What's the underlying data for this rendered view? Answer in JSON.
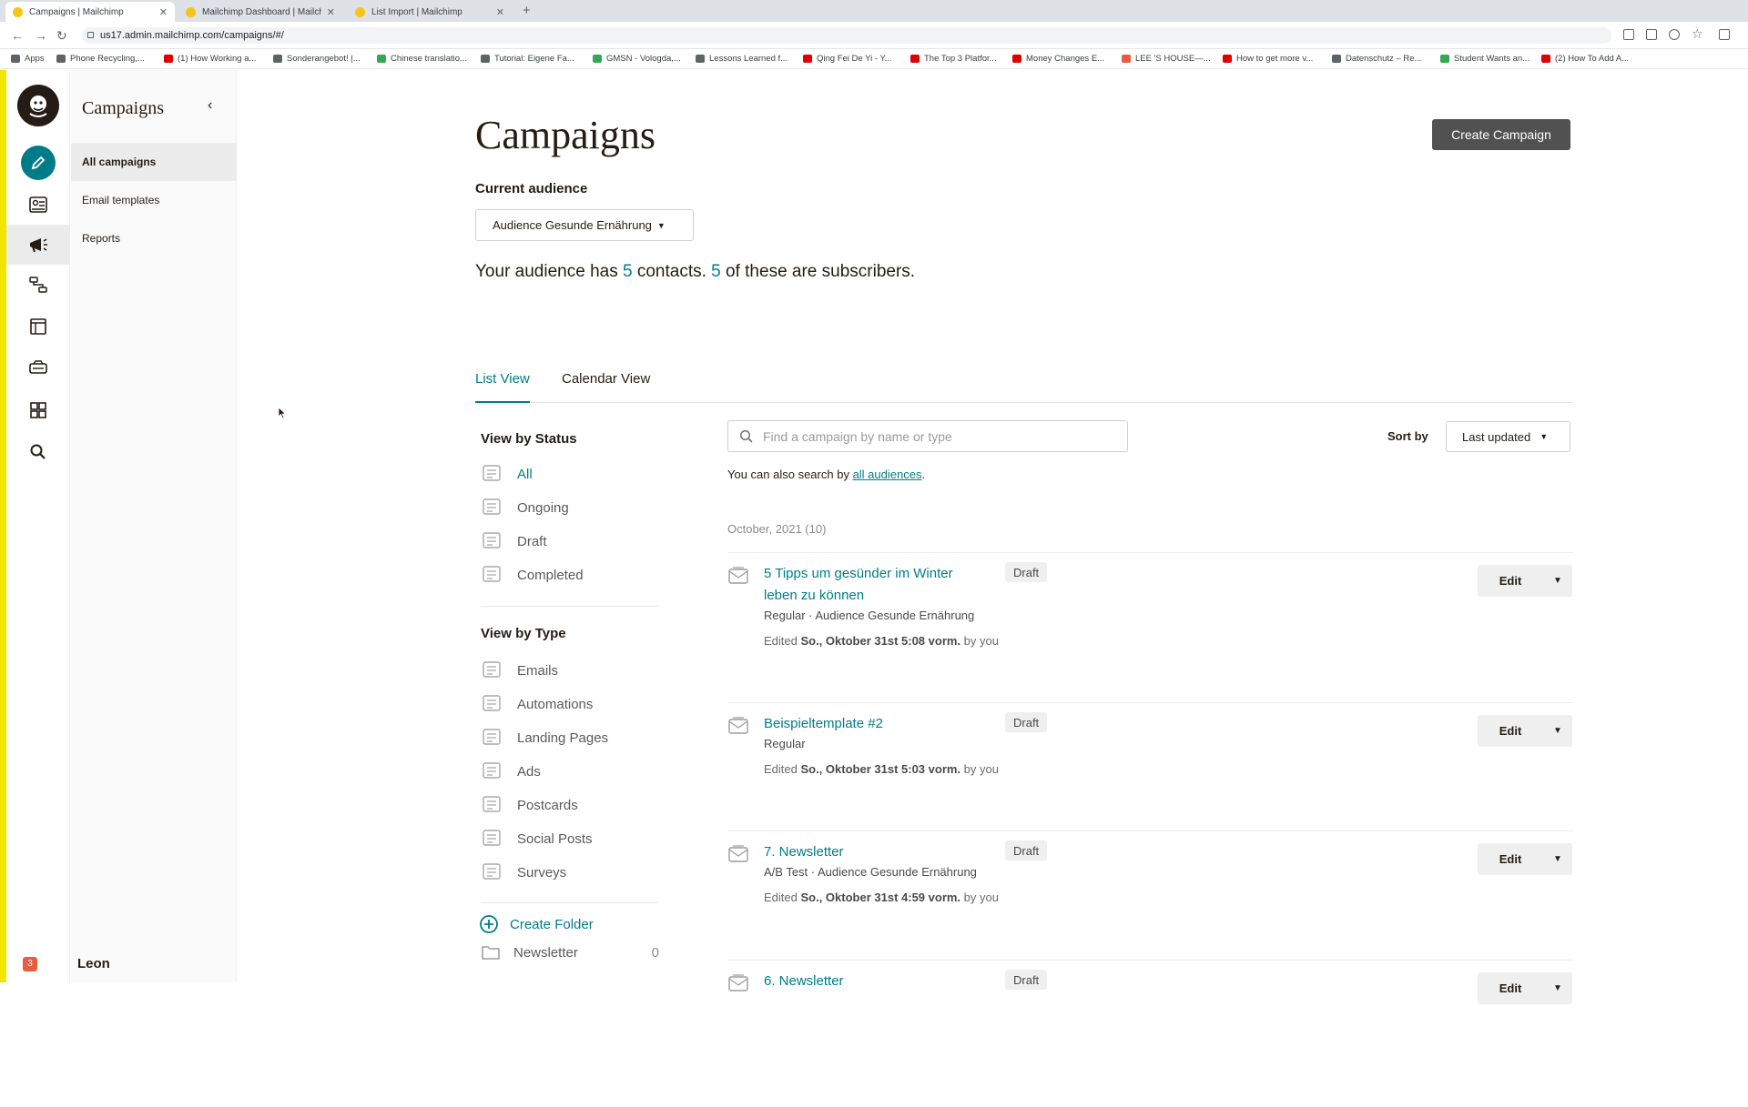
{
  "browser": {
    "tabs": [
      {
        "title": "Campaigns | Mailchimp"
      },
      {
        "title": "Mailchimp Dashboard | Mailch"
      },
      {
        "title": "List Import | Mailchimp"
      }
    ],
    "url": "us17.admin.mailchimp.com/campaigns/#/",
    "bookmarks": [
      {
        "label": "Apps",
        "color": "#5f6368"
      },
      {
        "label": "Phone Recycling,...",
        "color": "#5f6368"
      },
      {
        "label": "(1) How Working a...",
        "color": "#e00000"
      },
      {
        "label": "Sonderangebot! |...",
        "color": "#5f6368"
      },
      {
        "label": "Chinese translatio...",
        "color": "#34a853"
      },
      {
        "label": "Tutorial: Eigene Fa...",
        "color": "#5f6368"
      },
      {
        "label": "GMSN - Vologda,...",
        "color": "#34a853"
      },
      {
        "label": "Lessons Learned f...",
        "color": "#5f6368"
      },
      {
        "label": "Qing Fei De Yi - Y...",
        "color": "#e00000"
      },
      {
        "label": "The Top 3 Platfor...",
        "color": "#e00000"
      },
      {
        "label": "Money Changes E...",
        "color": "#e00000"
      },
      {
        "label": "LEE 'S HOUSE—...",
        "color": "#e85c41"
      },
      {
        "label": "How to get more v...",
        "color": "#e00000"
      },
      {
        "label": "Datenschutz – Re...",
        "color": "#5f6368"
      },
      {
        "label": "Student Wants an...",
        "color": "#34a853"
      },
      {
        "label": "(2) How To Add A...",
        "color": "#e00000"
      }
    ]
  },
  "sidebar": {
    "title": "Campaigns",
    "items": [
      {
        "label": "All campaigns"
      },
      {
        "label": "Email templates"
      },
      {
        "label": "Reports"
      }
    ],
    "notification_count": "3",
    "user_name": "Leon"
  },
  "page": {
    "title": "Campaigns",
    "create_button": "Create Campaign",
    "current_audience_label": "Current audience",
    "audience_select": "Audience Gesunde Ernährung",
    "audience_info": {
      "prefix": "Your audience has ",
      "contacts": "5",
      "middle": " contacts. ",
      "subscribers": "5",
      "suffix": " of these are subscribers."
    },
    "view_tabs": [
      {
        "label": "List View"
      },
      {
        "label": "Calendar View"
      }
    ]
  },
  "filters": {
    "status_heading": "View by Status",
    "status": [
      {
        "label": "All",
        "icon": "all-icon"
      },
      {
        "label": "Ongoing",
        "icon": "ongoing-icon"
      },
      {
        "label": "Draft",
        "icon": "draft-icon"
      },
      {
        "label": "Completed",
        "icon": "completed-icon"
      }
    ],
    "type_heading": "View by Type",
    "types": [
      {
        "label": "Emails",
        "icon": "email-icon"
      },
      {
        "label": "Automations",
        "icon": "automation-icon"
      },
      {
        "label": "Landing Pages",
        "icon": "landing-page-icon"
      },
      {
        "label": "Ads",
        "icon": "ads-icon"
      },
      {
        "label": "Postcards",
        "icon": "postcard-icon"
      },
      {
        "label": "Social Posts",
        "icon": "social-post-icon"
      },
      {
        "label": "Surveys",
        "icon": "survey-icon"
      }
    ],
    "create_folder": "Create Folder",
    "folders": [
      {
        "label": "Newsletter",
        "count": "0"
      }
    ]
  },
  "search": {
    "placeholder": "Find a campaign by name or type",
    "note_prefix": "You can also search by ",
    "note_link": "all audiences",
    "note_suffix": "."
  },
  "sort": {
    "label": "Sort by",
    "value": "Last updated"
  },
  "campaign_group": "October, 2021 (10)",
  "campaigns": [
    {
      "name": "5 Tipps um gesünder im Winter leben zu können",
      "type": "Regular · Audience Gesunde Ernährung",
      "edited_prefix": "Edited ",
      "edited_date": "So., Oktober 31st 5:08 vorm.",
      "edited_suffix": " by you",
      "status": "Draft",
      "action": "Edit"
    },
    {
      "name": "Beispieltemplate #2",
      "type": "Regular",
      "edited_prefix": "Edited ",
      "edited_date": "So., Oktober 31st 5:03 vorm.",
      "edited_suffix": " by you",
      "status": "Draft",
      "action": "Edit"
    },
    {
      "name": "7. Newsletter",
      "type": "A/B Test · Audience Gesunde Ernährung",
      "edited_prefix": "Edited ",
      "edited_date": "So., Oktober 31st 4:59 vorm.",
      "edited_suffix": " by you",
      "status": "Draft",
      "action": "Edit"
    },
    {
      "name": "6. Newsletter",
      "status": "Draft",
      "action": "Edit"
    }
  ],
  "colors": {
    "accent": "#007c89",
    "primary_button": "#515151",
    "edge": "#f2e600"
  }
}
